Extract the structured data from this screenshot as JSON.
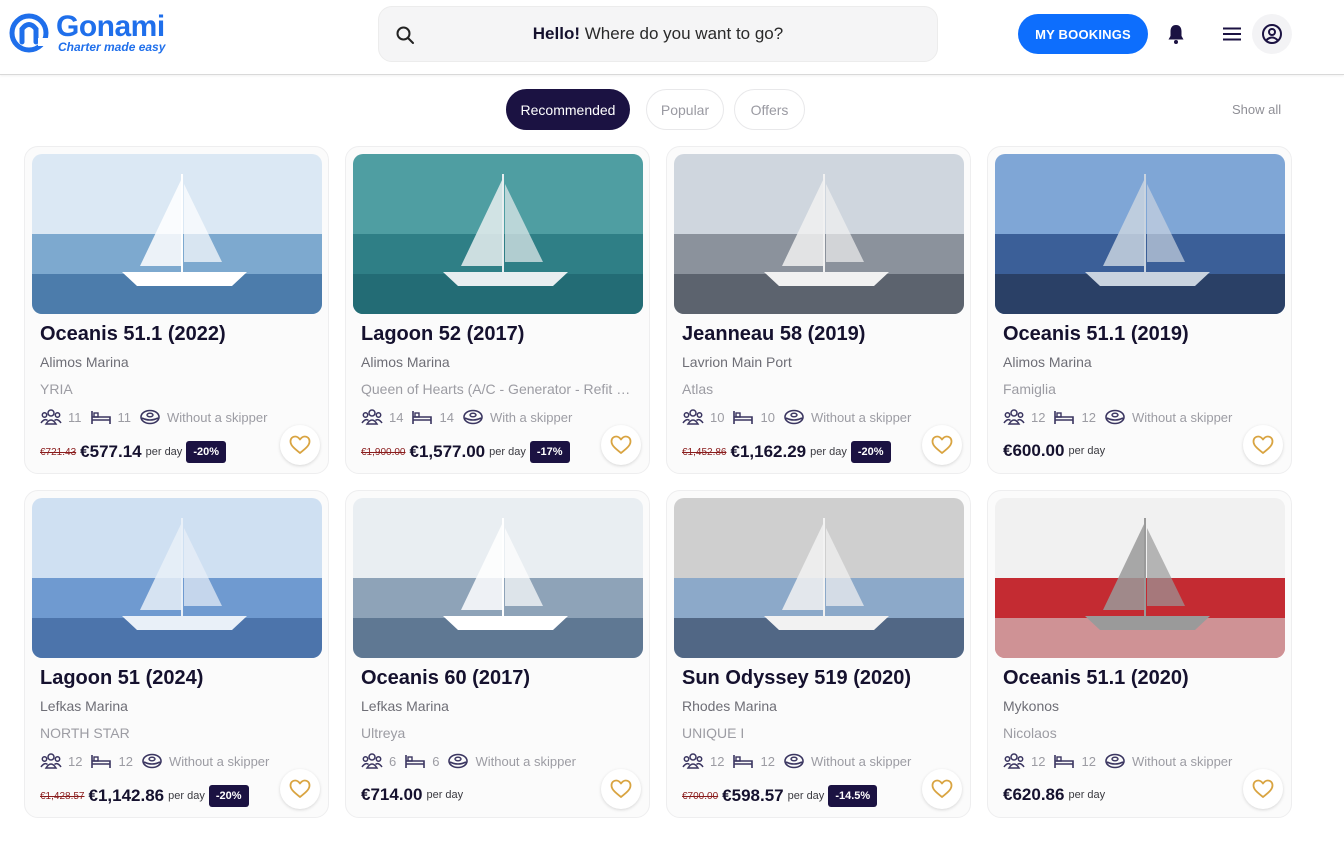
{
  "brand": {
    "name": "Gonami",
    "tagline": "Charter made easy",
    "color": "#1f6feb"
  },
  "search": {
    "greeting": "Hello!",
    "prompt": "Where do you want to go?"
  },
  "header": {
    "my_bookings_label": "MY BOOKINGS"
  },
  "tabs": [
    {
      "label": "Recommended",
      "active": true
    },
    {
      "label": "Popular",
      "active": false
    },
    {
      "label": "Offers",
      "active": false
    }
  ],
  "show_all_label": "Show all",
  "cards": [
    {
      "title": "Oceanis 51.1 (2022)",
      "marina": "Alimos Marina",
      "boat": "YRIA",
      "guests": "11",
      "cabins": "11",
      "skipper": "Without a skipper",
      "old_price": "€721.43",
      "price": "€577.14",
      "per_day": "per day",
      "discount": "-20%"
    },
    {
      "title": "Lagoon 52 (2017)",
      "marina": "Alimos Marina",
      "boat": "Queen of Hearts (A/C - Generator - Refit 2…",
      "guests": "14",
      "cabins": "14",
      "skipper": "With a skipper",
      "old_price": "€1,900.00",
      "price": "€1,577.00",
      "per_day": "per day",
      "discount": "-17%"
    },
    {
      "title": "Jeanneau 58 (2019)",
      "marina": "Lavrion Main Port",
      "boat": "Atlas",
      "guests": "10",
      "cabins": "10",
      "skipper": "Without a skipper",
      "old_price": "€1,452.86",
      "price": "€1,162.29",
      "per_day": "per day",
      "discount": "-20%"
    },
    {
      "title": "Oceanis 51.1 (2019)",
      "marina": "Alimos Marina",
      "boat": "Famiglia",
      "guests": "12",
      "cabins": "12",
      "skipper": "Without a skipper",
      "old_price": "",
      "price": "€600.00",
      "per_day": "per day",
      "discount": ""
    },
    {
      "title": "Lagoon 51 (2024)",
      "marina": "Lefkas Marina",
      "boat": "NORTH STAR",
      "guests": "12",
      "cabins": "12",
      "skipper": "Without a skipper",
      "old_price": "€1,428.57",
      "price": "€1,142.86",
      "per_day": "per day",
      "discount": "-20%"
    },
    {
      "title": "Oceanis 60 (2017)",
      "marina": "Lefkas Marina",
      "boat": "Ultreya",
      "guests": "6",
      "cabins": "6",
      "skipper": "Without a skipper",
      "old_price": "",
      "price": "€714.00",
      "per_day": "per day",
      "discount": ""
    },
    {
      "title": "Sun Odyssey 519 (2020)",
      "marina": "Rhodes Marina",
      "boat": "UNIQUE I",
      "guests": "12",
      "cabins": "12",
      "skipper": "Without a skipper",
      "old_price": "€700.00",
      "price": "€598.57",
      "per_day": "per day",
      "discount": "-14.5%"
    },
    {
      "title": "Oceanis 51.1 (2020)",
      "marina": "Mykonos",
      "boat": "Nicolaos",
      "guests": "12",
      "cabins": "12",
      "skipper": "Without a skipper",
      "old_price": "",
      "price": "€620.86",
      "per_day": "per day",
      "discount": ""
    }
  ]
}
